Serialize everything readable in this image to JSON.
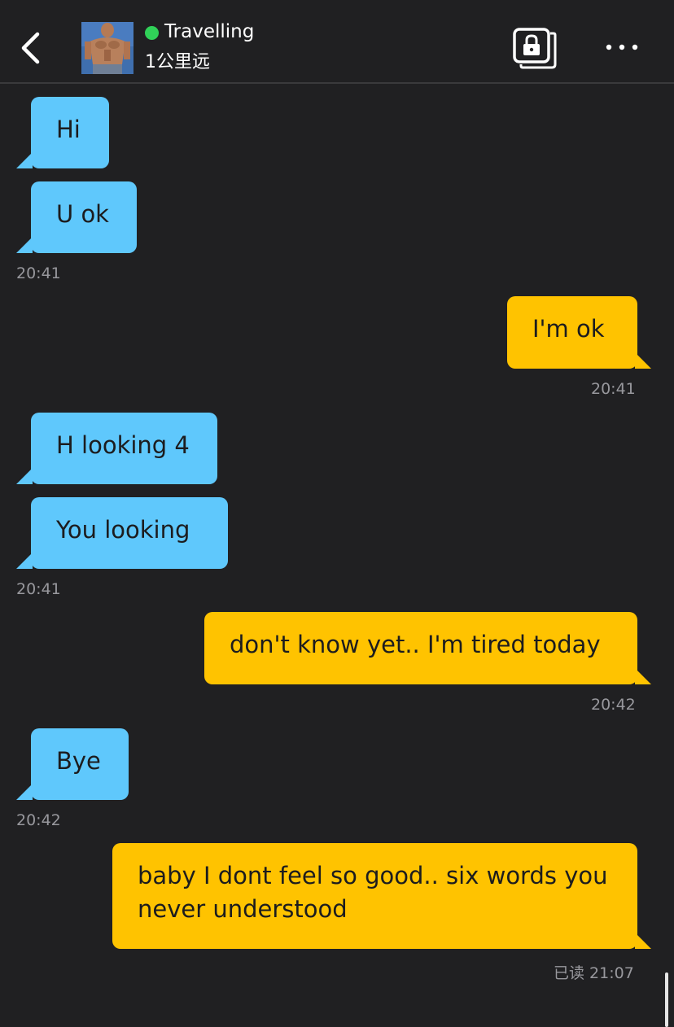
{
  "header": {
    "contact_name": "Travelling",
    "distance": "1公里远",
    "online_color": "#30d158",
    "back_icon": "chevron-left-icon",
    "album_icon": "private-album-lock-icon",
    "more_icon": "more-horizontal-icon"
  },
  "messages": [
    {
      "text": "Hi"
    },
    {
      "text": "U ok"
    },
    {
      "text": "I'm ok"
    },
    {
      "text": "H looking 4"
    },
    {
      "text": "You looking"
    },
    {
      "text": "don't know yet.. I'm tired today"
    },
    {
      "text": "Bye"
    },
    {
      "text": "baby I dont feel so good.. six words you never understood"
    }
  ],
  "timestamps": [
    "20:41",
    "20:41",
    "20:41",
    "20:42",
    "20:42",
    "已读 21:07"
  ],
  "colors": {
    "background": "#202022",
    "incoming_bubble": "#5fc8fc",
    "outgoing_bubble": "#ffc300",
    "timestamp": "#98989d"
  }
}
